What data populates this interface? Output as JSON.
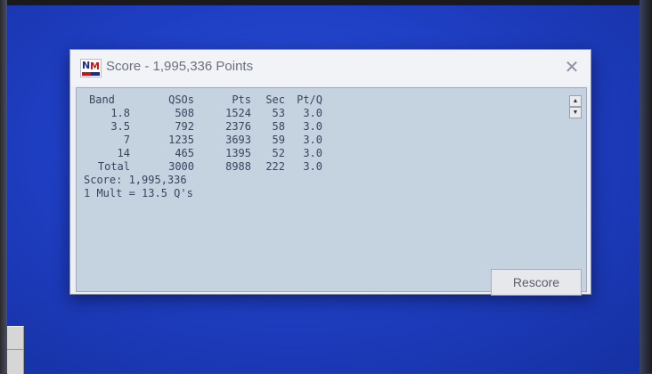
{
  "window": {
    "title": "Score - 1,995,336 Points",
    "close_glyph": "✕",
    "icon": "n1mm-logo-icon"
  },
  "table": {
    "headers": {
      "band": "Band",
      "qsos": "QSOs",
      "pts": "Pts",
      "sec": "Sec",
      "ptq": "Pt/Q"
    },
    "rows": [
      {
        "band": "1.8",
        "qsos": "508",
        "pts": "1524",
        "sec": "53",
        "ptq": "3.0"
      },
      {
        "band": "3.5",
        "qsos": "792",
        "pts": "2376",
        "sec": "58",
        "ptq": "3.0"
      },
      {
        "band": "7",
        "qsos": "1235",
        "pts": "3693",
        "sec": "59",
        "ptq": "3.0"
      },
      {
        "band": "14",
        "qsos": "465",
        "pts": "1395",
        "sec": "52",
        "ptq": "3.0"
      },
      {
        "band": "Total",
        "qsos": "3000",
        "pts": "8988",
        "sec": "222",
        "ptq": "3.0"
      }
    ]
  },
  "summary": {
    "score_line": "Score: 1,995,336",
    "mult_line": "1 Mult = 13.5 Q's"
  },
  "scrollbar": {
    "up_glyph": "▲",
    "down_glyph": "▼"
  },
  "buttons": {
    "rescore": "Rescore"
  },
  "colors": {
    "desktop": "#1f3fc4",
    "client_bg": "#c5d2df",
    "text": "#3a4560"
  }
}
